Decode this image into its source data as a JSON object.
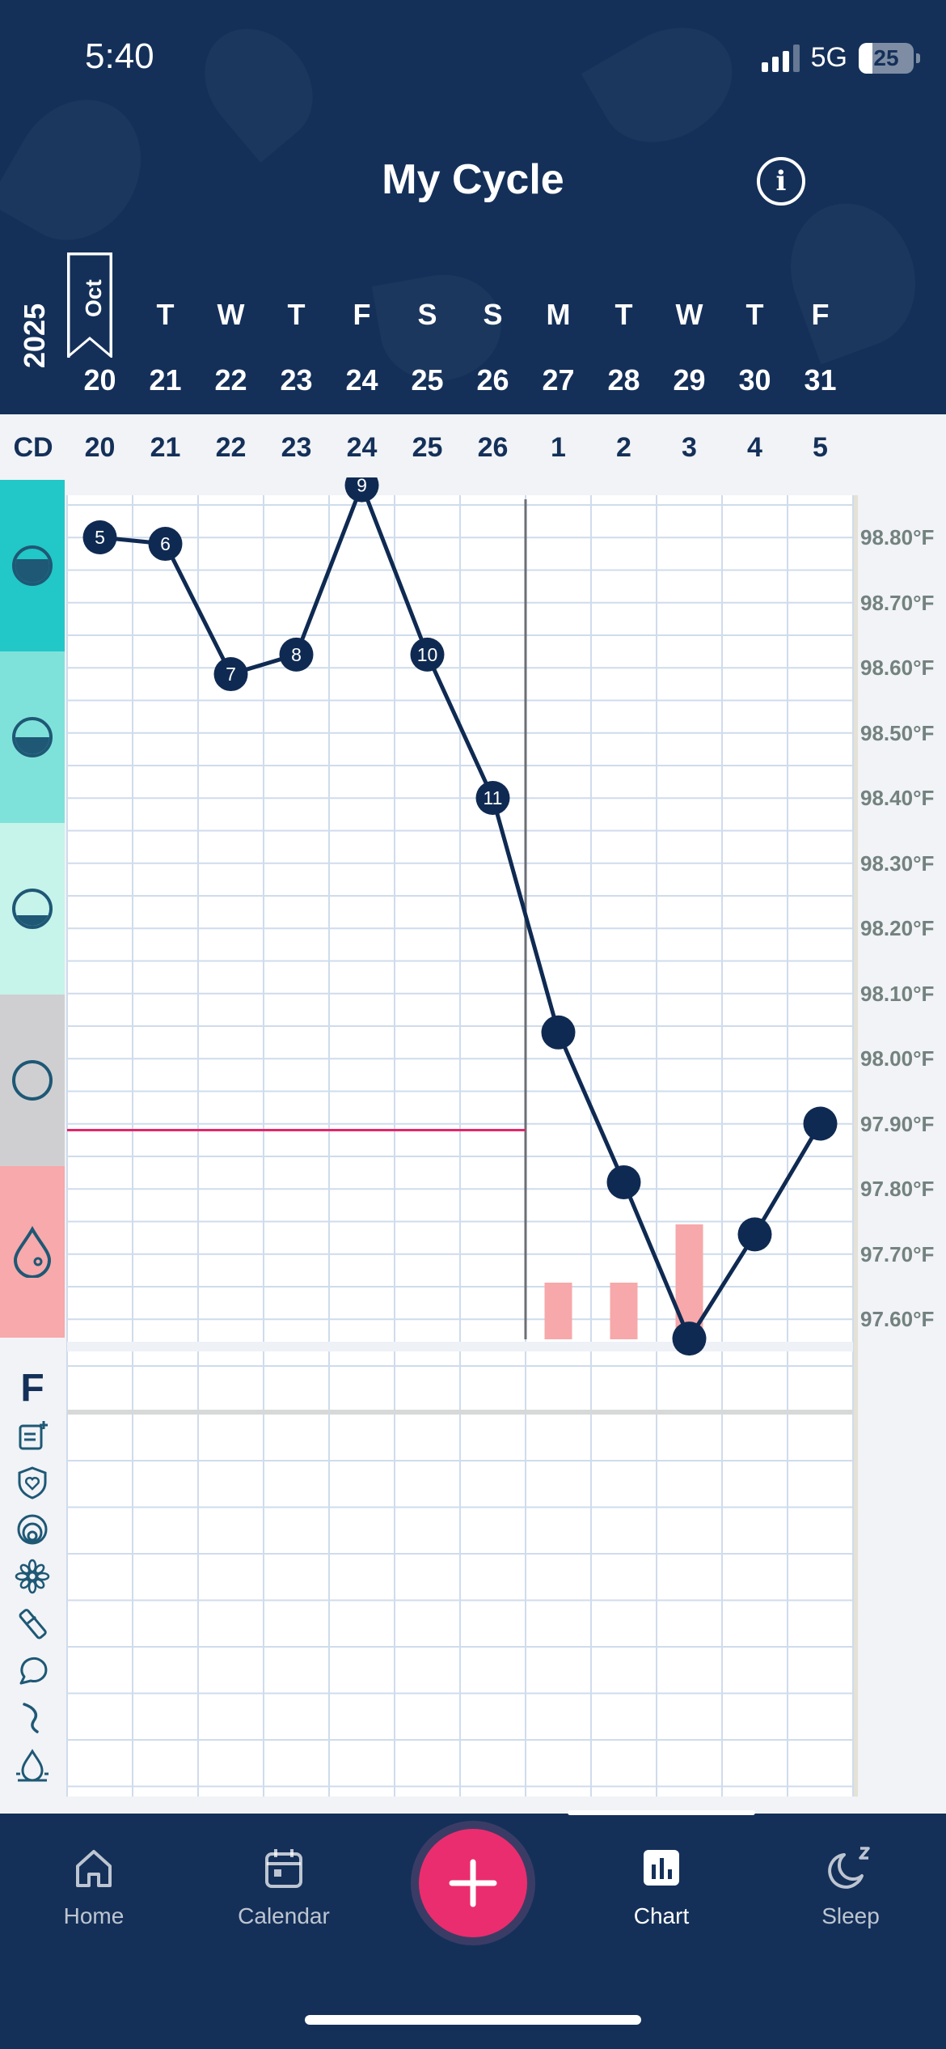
{
  "status_bar": {
    "time": "5:40",
    "network": "5G",
    "battery": "25"
  },
  "header": {
    "title": "My Cycle",
    "year": "2025",
    "month": "Oct"
  },
  "days": [
    {
      "dow": "",
      "date": "20",
      "cd": "20"
    },
    {
      "dow": "T",
      "date": "21",
      "cd": "21"
    },
    {
      "dow": "W",
      "date": "22",
      "cd": "22"
    },
    {
      "dow": "T",
      "date": "23",
      "cd": "23"
    },
    {
      "dow": "F",
      "date": "24",
      "cd": "24"
    },
    {
      "dow": "S",
      "date": "25",
      "cd": "25"
    },
    {
      "dow": "S",
      "date": "26",
      "cd": "26"
    },
    {
      "dow": "M",
      "date": "27",
      "cd": "1"
    },
    {
      "dow": "T",
      "date": "28",
      "cd": "2"
    },
    {
      "dow": "W",
      "date": "29",
      "cd": "3"
    },
    {
      "dow": "T",
      "date": "30",
      "cd": "4"
    },
    {
      "dow": "F",
      "date": "31",
      "cd": "5"
    }
  ],
  "cd_label": "CD",
  "fertility_row_label": "F",
  "chart_data": {
    "type": "line",
    "x": [
      "20",
      "21",
      "22",
      "23",
      "24",
      "25",
      "26",
      "27",
      "28",
      "29",
      "30",
      "31"
    ],
    "series": [
      {
        "values": [
          98.8,
          98.79,
          98.59,
          98.62,
          98.88,
          98.62,
          98.4,
          98.04,
          97.81,
          97.57,
          97.73,
          97.9
        ],
        "point_labels": [
          "5",
          "6",
          "7",
          "8",
          "9",
          "10",
          "11",
          "",
          "",
          "",
          "",
          ""
        ]
      }
    ],
    "bleeding_bars": [
      0,
      0,
      0,
      0,
      0,
      0,
      0,
      1,
      1,
      2,
      0,
      0
    ],
    "coverline": 97.89,
    "coverline_until_index": 6,
    "cycle_start_index": 7,
    "y_tick_labels": [
      "98.80°F",
      "98.70°F",
      "98.60°F",
      "98.50°F",
      "98.40°F",
      "98.30°F",
      "98.20°F",
      "98.10°F",
      "98.00°F",
      "97.90°F",
      "97.80°F",
      "97.70°F",
      "97.60°F"
    ],
    "y_ticks": [
      98.8,
      98.7,
      98.6,
      98.5,
      98.4,
      98.3,
      98.2,
      98.1,
      98.0,
      97.9,
      97.8,
      97.7,
      97.6
    ],
    "ylim": [
      97.55,
      98.87
    ],
    "colors": {
      "line": "#0f2a52",
      "coverline": "#e3266a",
      "bleeding": "#f7a8aa",
      "grid": "#cfdcec"
    }
  },
  "phase_strip": [
    {
      "name": "peak",
      "icon": "circle-icon",
      "color": "#22c7c7"
    },
    {
      "name": "high",
      "icon": "circle-icon",
      "color": "#7fe2da"
    },
    {
      "name": "low",
      "icon": "circle-icon",
      "color": "#c6f3ea"
    },
    {
      "name": "none",
      "icon": "circle-icon",
      "color": "#cfcfd1"
    },
    {
      "name": "period",
      "icon": "drop-icon",
      "color": "#f7a9ab"
    }
  ],
  "side_icons": [
    "note-add-icon",
    "shield-heart-icon",
    "spiral-icon",
    "flower-icon",
    "test-strip-icon",
    "speech-bubble-icon",
    "cervix-icon",
    "fluid-icon"
  ],
  "nav": {
    "home": "Home",
    "calendar": "Calendar",
    "chart": "Chart",
    "sleep": "Sleep"
  }
}
